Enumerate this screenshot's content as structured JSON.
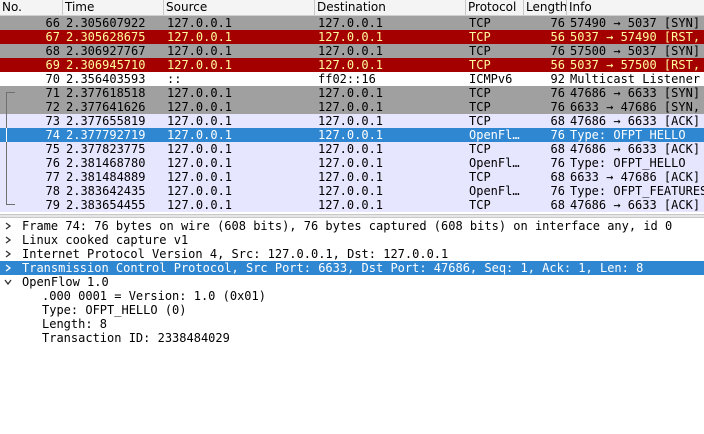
{
  "columns": {
    "no": "No.",
    "time": "Time",
    "source": "Source",
    "destination": "Destination",
    "protocol": "Protocol",
    "length": "Length",
    "info": "Info"
  },
  "colors": {
    "grey_row": "#a0a0a0",
    "red_row": "#a40000",
    "red_text": "#fffc9c",
    "lavender_row": "#e7e6ff",
    "white_row": "#ffffff",
    "selected": "#2f87d1"
  },
  "packets": [
    {
      "no": "66",
      "time": "2.305607922",
      "src": "127.0.0.1",
      "dst": "127.0.0.1",
      "proto": "TCP",
      "len": "76",
      "info": "57490 → 5037 [SYN]",
      "style": "grey"
    },
    {
      "no": "67",
      "time": "2.305628675",
      "src": "127.0.0.1",
      "dst": "127.0.0.1",
      "proto": "TCP",
      "len": "56",
      "info": "5037 → 57490 [RST,",
      "style": "red"
    },
    {
      "no": "68",
      "time": "2.306927767",
      "src": "127.0.0.1",
      "dst": "127.0.0.1",
      "proto": "TCP",
      "len": "76",
      "info": "57500 → 5037 [SYN]",
      "style": "grey"
    },
    {
      "no": "69",
      "time": "2.306945710",
      "src": "127.0.0.1",
      "dst": "127.0.0.1",
      "proto": "TCP",
      "len": "56",
      "info": "5037 → 57500 [RST,",
      "style": "red"
    },
    {
      "no": "70",
      "time": "2.356403593",
      "src": "::",
      "dst": "ff02::16",
      "proto": "ICMPv6",
      "len": "92",
      "info": "Multicast Listener",
      "style": "white"
    },
    {
      "no": "71",
      "time": "2.377618518",
      "src": "127.0.0.1",
      "dst": "127.0.0.1",
      "proto": "TCP",
      "len": "76",
      "info": "47686 → 6633 [SYN]",
      "style": "grey",
      "ind": "top"
    },
    {
      "no": "72",
      "time": "2.377641626",
      "src": "127.0.0.1",
      "dst": "127.0.0.1",
      "proto": "TCP",
      "len": "76",
      "info": "6633 → 47686 [SYN,",
      "style": "grey",
      "ind": "mid"
    },
    {
      "no": "73",
      "time": "2.377655819",
      "src": "127.0.0.1",
      "dst": "127.0.0.1",
      "proto": "TCP",
      "len": "68",
      "info": "47686 → 6633 [ACK]",
      "style": "lavender",
      "ind": "mid"
    },
    {
      "no": "74",
      "time": "2.377792719",
      "src": "127.0.0.1",
      "dst": "127.0.0.1",
      "proto": "OpenFl…",
      "len": "76",
      "info": "Type: OFPT_HELLO",
      "style": "selected",
      "ind": "mid"
    },
    {
      "no": "75",
      "time": "2.377823775",
      "src": "127.0.0.1",
      "dst": "127.0.0.1",
      "proto": "TCP",
      "len": "68",
      "info": "47686 → 6633 [ACK]",
      "style": "lavender",
      "ind": "mid"
    },
    {
      "no": "76",
      "time": "2.381468780",
      "src": "127.0.0.1",
      "dst": "127.0.0.1",
      "proto": "OpenFl…",
      "len": "76",
      "info": "Type: OFPT_HELLO",
      "style": "lavender",
      "ind": "mid"
    },
    {
      "no": "77",
      "time": "2.381484889",
      "src": "127.0.0.1",
      "dst": "127.0.0.1",
      "proto": "TCP",
      "len": "68",
      "info": "6633 → 47686 [ACK]",
      "style": "lavender",
      "ind": "mid"
    },
    {
      "no": "78",
      "time": "2.383642435",
      "src": "127.0.0.1",
      "dst": "127.0.0.1",
      "proto": "OpenFl…",
      "len": "76",
      "info": "Type: OFPT_FEATURES",
      "style": "lavender",
      "ind": "mid"
    },
    {
      "no": "79",
      "time": "2.383654455",
      "src": "127.0.0.1",
      "dst": "127.0.0.1",
      "proto": "TCP",
      "len": "68",
      "info": "47686 → 6633 [ACK]",
      "style": "lavender",
      "ind": "bot"
    }
  ],
  "details": [
    {
      "text": "Frame 74: 76 bytes on wire (608 bits), 76 bytes captured (608 bits) on interface any, id 0",
      "expanded": false,
      "selected": false
    },
    {
      "text": "Linux cooked capture v1",
      "expanded": false,
      "selected": false
    },
    {
      "text": "Internet Protocol Version 4, Src: 127.0.0.1, Dst: 127.0.0.1",
      "expanded": false,
      "selected": false
    },
    {
      "text": "Transmission Control Protocol, Src Port: 6633, Dst Port: 47686, Seq: 1, Ack: 1, Len: 8",
      "expanded": false,
      "selected": true
    },
    {
      "text": "OpenFlow 1.0",
      "expanded": true,
      "selected": false
    }
  ],
  "openflow_fields": [
    ".000 0001 = Version: 1.0 (0x01)",
    "Type: OFPT_HELLO (0)",
    "Length: 8",
    "Transaction ID: 2338484029"
  ]
}
